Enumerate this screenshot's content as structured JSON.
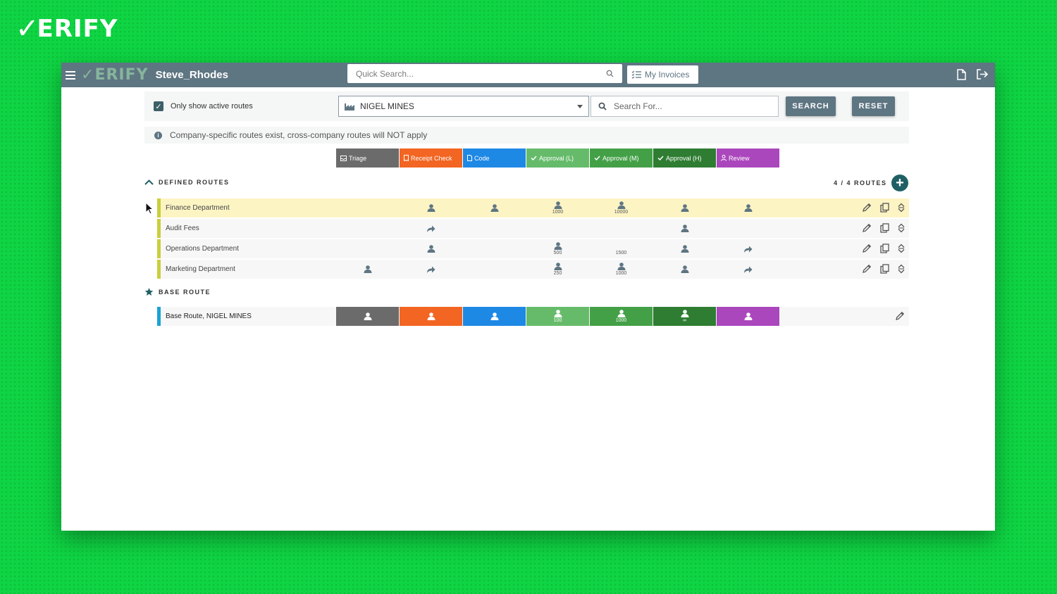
{
  "brand": {
    "outer_logo": "ERIFY",
    "inner_logo": "ERIFY"
  },
  "topbar": {
    "username": "Steve_Rhodes",
    "quick_search_placeholder": "Quick Search...",
    "my_invoices_label": "My Invoices"
  },
  "filters": {
    "only_active_label": "Only show active routes",
    "only_active_checked": true,
    "company_selected": "NIGEL MINES",
    "search_placeholder": "Search For...",
    "search_button": "SEARCH",
    "reset_button": "RESET"
  },
  "info_message": "Company-specific routes exist, cross-company routes will NOT apply",
  "stages": [
    {
      "label": "Triage",
      "color": "#6b6b6b",
      "icon": "inbox-icon"
    },
    {
      "label": "Receipt Check",
      "color": "#f26522",
      "icon": "receipt-icon"
    },
    {
      "label": "Code",
      "color": "#1e88e5",
      "icon": "document-icon"
    },
    {
      "label": "Approval (L)",
      "color": "#66bb6a",
      "icon": "check-icon"
    },
    {
      "label": "Approval (M)",
      "color": "#43a047",
      "icon": "check-icon"
    },
    {
      "label": "Approval (H)",
      "color": "#2e7d32",
      "icon": "check-icon"
    },
    {
      "label": "Review",
      "color": "#ab47bc",
      "icon": "user-icon"
    }
  ],
  "defined_routes": {
    "title": "DEFINED ROUTES",
    "count_label": "4 / 4 ROUTES",
    "marker_color": "#c9cf3c",
    "rows": [
      {
        "name": "Finance Department",
        "highlight": true,
        "cells": [
          null,
          {
            "icon": "user"
          },
          {
            "icon": "user"
          },
          {
            "icon": "user",
            "num": "1000"
          },
          {
            "icon": "user",
            "num": "10000"
          },
          {
            "icon": "user"
          },
          {
            "icon": "user"
          }
        ]
      },
      {
        "name": "Audit Fees",
        "highlight": false,
        "cells": [
          null,
          {
            "icon": "forward"
          },
          null,
          null,
          null,
          {
            "icon": "user"
          },
          null
        ]
      },
      {
        "name": "Operations Department",
        "highlight": false,
        "cells": [
          null,
          {
            "icon": "user"
          },
          null,
          {
            "icon": "user",
            "num": "500"
          },
          {
            "icon": "",
            "num": "1500"
          },
          {
            "icon": "user"
          },
          {
            "icon": "forward"
          }
        ]
      },
      {
        "name": "Marketing Department",
        "highlight": false,
        "cells": [
          {
            "icon": "user"
          },
          {
            "icon": "forward"
          },
          null,
          {
            "icon": "user",
            "num": "250"
          },
          {
            "icon": "user",
            "num": "1000"
          },
          {
            "icon": "user"
          },
          {
            "icon": "forward"
          }
        ]
      }
    ]
  },
  "base_route": {
    "title": "BASE ROUTE",
    "marker_color": "#1aa3d4",
    "name": "Base Route, NIGEL MINES",
    "cells": [
      {
        "icon": "user"
      },
      {
        "icon": "user"
      },
      {
        "icon": "user"
      },
      {
        "icon": "user",
        "num": "100"
      },
      {
        "icon": "user",
        "num": "1000"
      },
      {
        "icon": "user",
        "num": "∞"
      },
      {
        "icon": "user"
      }
    ]
  }
}
